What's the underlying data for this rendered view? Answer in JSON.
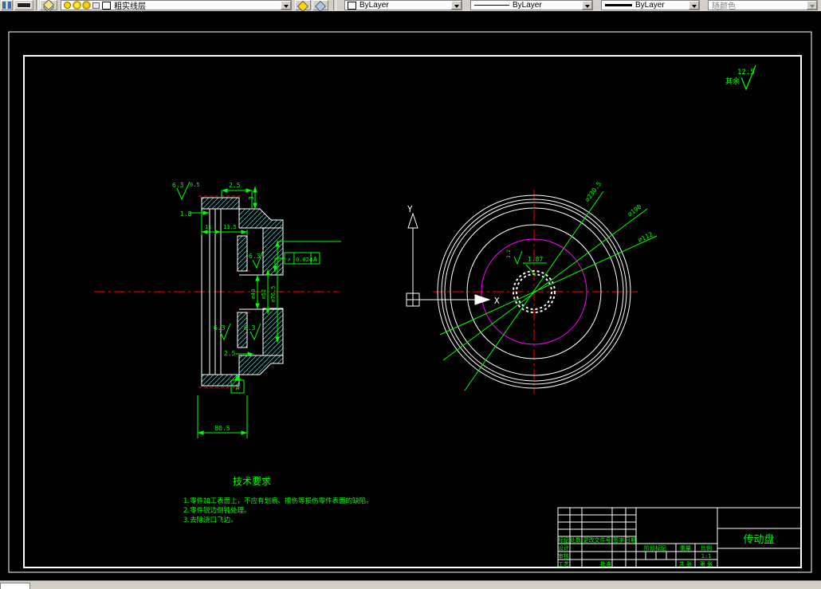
{
  "toolbar": {
    "layer_value": "粗实线层",
    "color_value": "ByLayer",
    "linetype_value": "ByLayer",
    "lineweight_value": "ByLayer",
    "plotstyle_value": "随颜色"
  },
  "annotations": {
    "general_roughness_prefix": "其余",
    "general_roughness_value": "12.5"
  },
  "section_view": {
    "rough_top": "6.3",
    "dim_width_small": "0.5",
    "dim_top": "2.5",
    "dim_depth": "3",
    "dim_wall": "1.8",
    "dim_len1": "11",
    "dim_len2": "13.5",
    "rough_bore": "6.3",
    "gdt_symbol": "↗",
    "gdt_value": "0.024",
    "gdt_datum": "A",
    "dia_small": "⌀40",
    "dia_mid": "⌀52",
    "dia_large": "⌀76.5",
    "rough_bottom_left": "6.3",
    "rough_bottom_right": "6.3",
    "dim_bottom_r": "2.5",
    "datum_label": "A",
    "dim_overall": "80.5"
  },
  "front_view": {
    "dia_outer": "⌀230.5",
    "dia_bolt": "⌀190",
    "dia_hub": "⌀112",
    "spline_rough": "3.2",
    "spline_dim": "1.87",
    "axis_x": "X",
    "axis_y": "Y"
  },
  "tech_req": {
    "title": "技术要求",
    "line1": "1.零件加工表面上，不应有划痕、擦伤等损伤零件表面的缺陷。",
    "line2": "2.零件锐边倒钝处理。",
    "line3": "3.去除浇口飞边。"
  },
  "title_block": {
    "part_name": "传动盘",
    "h_mark": "标记",
    "h_count": "处数",
    "h_file": "更改文件号",
    "h_sign": "签字",
    "h_date": "日期",
    "r_design": "设计",
    "r_check": "审核",
    "r_process": "工艺",
    "r_approve": "批准",
    "stage": "阶段标记",
    "weight": "重量",
    "scale": "比例",
    "scale_value": "1:1",
    "sheet_total": "共 张",
    "sheet_no": "第 张"
  }
}
